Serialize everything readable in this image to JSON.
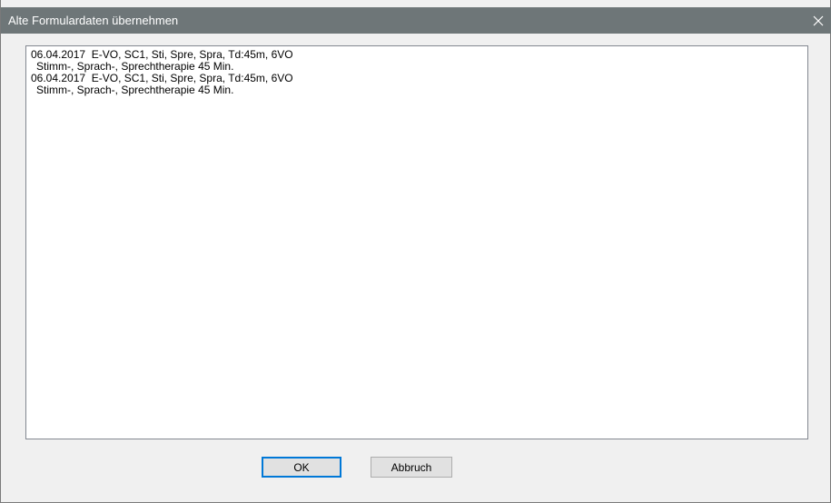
{
  "window": {
    "title": "Alte Formulardaten übernehmen",
    "close_icon": "close-icon"
  },
  "list": {
    "items": [
      {
        "line1": "06.04.2017  E-VO, SC1, Sti, Spre, Spra, Td:45m, 6VO",
        "line2": "Stimm-, Sprach-, Sprechtherapie 45 Min."
      },
      {
        "line1": "06.04.2017  E-VO, SC1, Sti, Spre, Spra, Td:45m, 6VO",
        "line2": "Stimm-, Sprach-, Sprechtherapie 45 Min."
      }
    ]
  },
  "buttons": {
    "ok_label": "OK",
    "cancel_label": "Abbruch"
  },
  "colors": {
    "titlebar": "#6e7678",
    "dialog_bg": "#f0f0f0",
    "default_button_border": "#0078d7"
  }
}
